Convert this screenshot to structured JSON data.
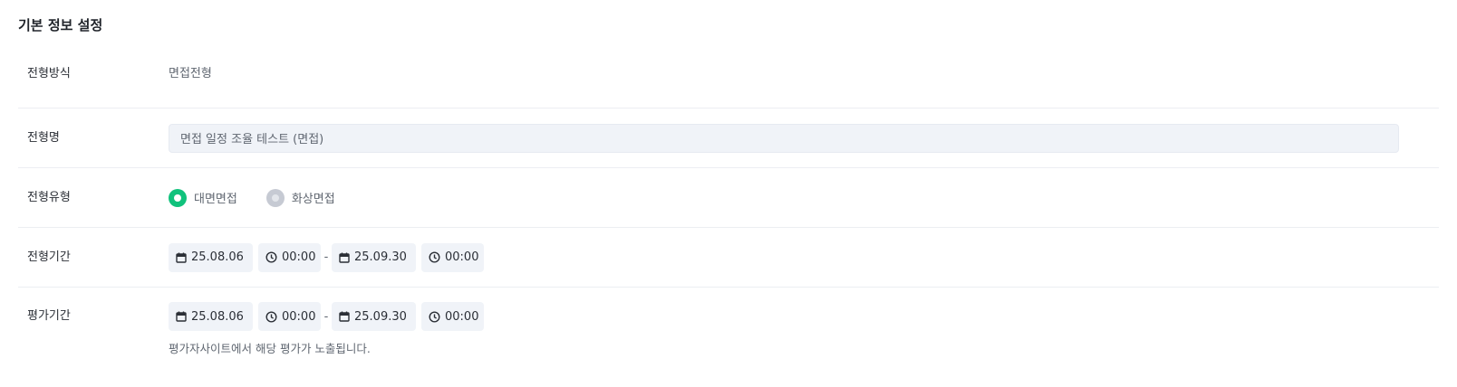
{
  "section": {
    "title": "기본 정보 설정"
  },
  "fields": {
    "method": {
      "label": "전형방식",
      "value": "면접전형"
    },
    "name": {
      "label": "전형명",
      "value": "면접 일정 조율 테스트 (면접)"
    },
    "type": {
      "label": "전형유형",
      "options": [
        {
          "label": "대면면접",
          "selected": true
        },
        {
          "label": "화상면접",
          "selected": false
        }
      ]
    },
    "stage_period": {
      "label": "전형기간",
      "start_date": "25.08.06",
      "start_time": "00:00",
      "separator": "-",
      "end_date": "25.09.30",
      "end_time": "00:00"
    },
    "eval_period": {
      "label": "평가기간",
      "start_date": "25.08.06",
      "start_time": "00:00",
      "separator": "-",
      "end_date": "25.09.30",
      "end_time": "00:00",
      "hint": "평가자사이트에서 해당 평가가 노출됩니다."
    }
  },
  "icons": {
    "date": "calendar-icon",
    "time": "clock-icon"
  },
  "colors": {
    "accent": "#10c27c",
    "input_bg": "#f0f3f8",
    "radio_off": "#c6cad3"
  }
}
